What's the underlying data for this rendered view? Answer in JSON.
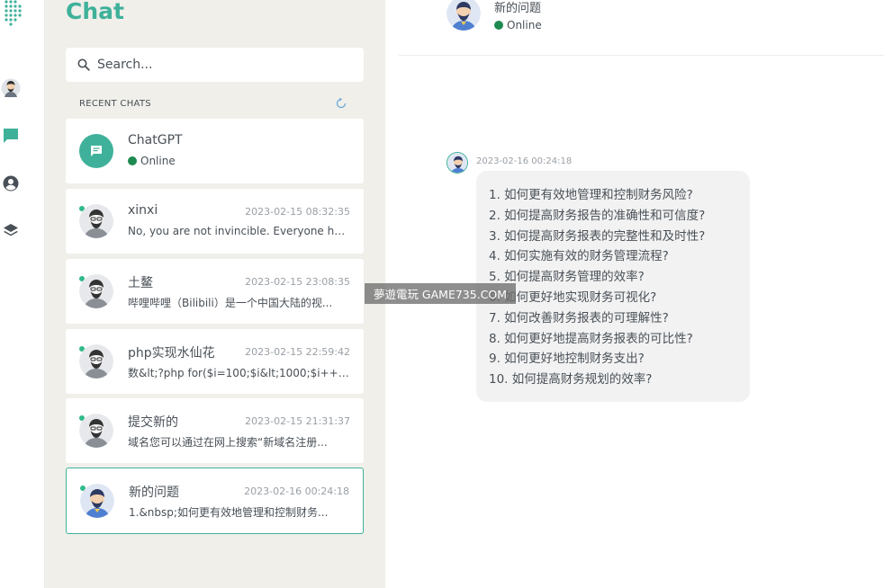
{
  "app": {
    "title": "Chat"
  },
  "search": {
    "placeholder": "Search..."
  },
  "recent": {
    "label": "RECENT CHATS"
  },
  "chats": [
    {
      "name": "ChatGPT",
      "status": "Online",
      "type": "bot"
    },
    {
      "name": "xinxi",
      "time": "2023-02-15 08:32:35",
      "preview": "No, you are not invincible. Everyone has..."
    },
    {
      "name": "土鳌",
      "time": "2023-02-15 23:08:35",
      "preview": "哔哩哔哩（Bilibili）是一个中国大陆的视..."
    },
    {
      "name": "php实现水仙花",
      "time": "2023-02-15 22:59:42",
      "preview": "数&lt;?php for($i=100;$i&lt;1000;$i++)..."
    },
    {
      "name": "提交新的",
      "time": "2023-02-15 21:31:37",
      "preview": "域名您可以通过在网上搜索“新域名注册..."
    },
    {
      "name": "新的问题",
      "time": "2023-02-16 00:24:18",
      "preview": "1.&nbsp;如何更有效地管理和控制财务...",
      "active": true
    }
  ],
  "conversation": {
    "name": "新的问题",
    "status": "Online",
    "message_time": "2023-02-16 00:24:18",
    "lines": [
      "1. 如何更有效地管理和控制财务风险?",
      "2. 如何提高财务报告的准确性和可信度?",
      "3. 如何提高财务报表的完整性和及时性?",
      "4. 如何实施有效的财务管理流程?",
      "5. 如何提高财务管理的效率?",
      "6. 如何更好地实现财务可视化?",
      "7. 如何改善财务报表的可理解性?",
      "8. 如何更好地提高财务报表的可比性?",
      "9. 如何更好地控制财务支出?",
      "10. 如何提高财务规划的效率?"
    ]
  },
  "watermark": "夢遊電玩 GAME735.COM",
  "colors": {
    "accent": "#3fb19a",
    "online": "#1d8a50",
    "panel": "#f0efea"
  },
  "icons": {
    "logo": "logo-icon",
    "profile": "profile-icon",
    "chats": "chat-bubble-icon",
    "contacts": "user-circle-icon",
    "layers": "layers-icon",
    "search": "search-icon",
    "refresh": "refresh-icon"
  }
}
